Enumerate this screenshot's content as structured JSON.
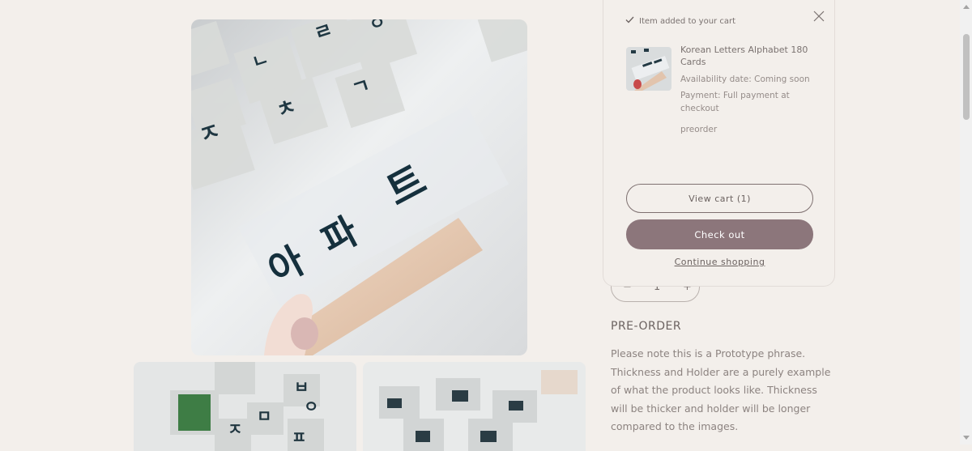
{
  "cart_popup": {
    "added_text": "Item added to your cart",
    "product_title": "Korean Letters Alphabet 180 Cards",
    "availability": "Availability date: Coming soon",
    "payment": "Payment: Full payment at checkout",
    "tag": "preorder",
    "view_cart": "View cart (1)",
    "checkout": "Check out",
    "continue": "Continue shopping"
  },
  "quantity": {
    "minus": "−",
    "value": "1",
    "plus": "+"
  },
  "product": {
    "preorder_label": "PRE-ORDER",
    "description": "Please note this is a Prototype phrase. Thickness and Holder are a purely example of what the product looks like. Thickness will be thicker and holder will be longer compared to the images."
  },
  "main_image": {
    "letters": [
      "ㄹ",
      "ㅇ",
      "ㄴ",
      "ㄱ",
      "ㅈ",
      "ㅊ",
      "아",
      "파",
      "트"
    ]
  },
  "thumb1": {
    "letters": [
      "ㅂ",
      "ㅁ",
      "ㅇ",
      "ㅈ",
      "ㅍ"
    ]
  },
  "colors": {
    "page_bg": "#f3efeb",
    "checkout_btn": "#8c767b",
    "text": "#7a7270"
  }
}
